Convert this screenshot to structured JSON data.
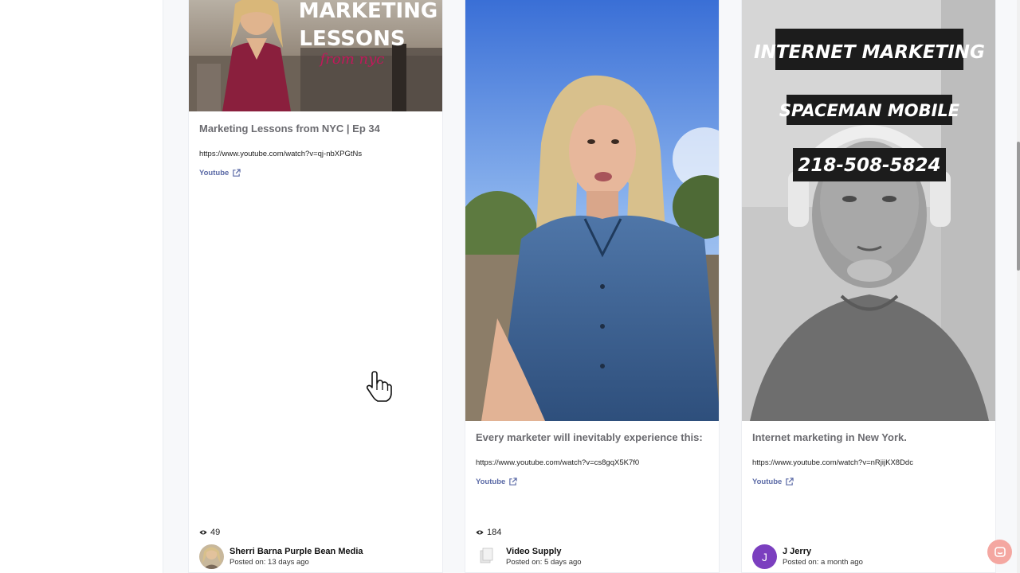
{
  "cards": [
    {
      "title": "Marketing Lessons from NYC | Ep 34",
      "url": "https://www.youtube.com/watch?v=qj-nbXPGtNs",
      "link_label": "Youtube",
      "views": "49",
      "author": "Sherri Barna Purple Bean Media",
      "posted": "Posted on: 13 days ago",
      "thumb_text_line1": "MARKETING",
      "thumb_text_line2": "LESSONS",
      "thumb_text_line3": "from nyc"
    },
    {
      "title": "Every marketer will inevitably experience this:",
      "url": "https://www.youtube.com/watch?v=cs8gqX5K7f0",
      "link_label": "Youtube",
      "views": "184",
      "author": "Video Supply",
      "posted": "Posted on: 5 days ago"
    },
    {
      "title": "Internet marketing in New York.",
      "url": "https://www.youtube.com/watch?v=nRjijKX8Ddc",
      "link_label": "Youtube",
      "author": "J Jerry",
      "avatar_letter": "J",
      "posted": "Posted on: a month ago",
      "thumb_text_line1": "INTERNET MARKETING",
      "thumb_text_line2": "SPACEMAN MOBILE",
      "thumb_text_line3": "218-508-5824"
    }
  ],
  "colors": {
    "link": "#5b6aa6",
    "title": "#6b6b70",
    "chat_button": "#f4a7a1",
    "avatar_j": "#7b3fbf"
  },
  "icons": {
    "external_link": "external-link-icon",
    "views": "eye-icon",
    "chat": "chat-icon",
    "cursor": "hand-cursor-icon"
  }
}
